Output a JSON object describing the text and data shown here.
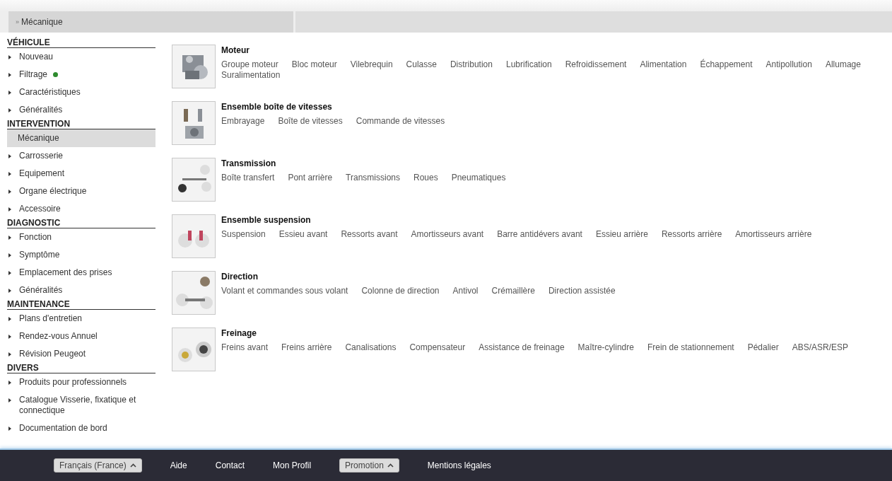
{
  "breadcrumb": {
    "marker": "»",
    "label": "Mécanique"
  },
  "sidebar": {
    "sections": [
      {
        "heading": "VÉHICULE",
        "items": [
          {
            "label": "Nouveau",
            "selected": false
          },
          {
            "label": "Filtrage",
            "selected": false,
            "color": "#2e8b2e"
          },
          {
            "label": "Caractéristiques",
            "selected": false
          },
          {
            "label": "Généralités",
            "selected": false
          }
        ]
      },
      {
        "heading": "INTERVENTION",
        "items": [
          {
            "label": "Mécanique",
            "selected": true
          },
          {
            "label": "Carrosserie",
            "selected": false
          },
          {
            "label": "Equipement",
            "selected": false
          },
          {
            "label": "Organe électrique",
            "selected": false
          },
          {
            "label": "Accessoire",
            "selected": false
          }
        ]
      },
      {
        "heading": "DIAGNOSTIC",
        "items": [
          {
            "label": "Fonction",
            "selected": false
          },
          {
            "label": "Symptôme",
            "selected": false
          },
          {
            "label": "Emplacement des prises",
            "selected": false
          },
          {
            "label": "Généralités",
            "selected": false
          }
        ]
      },
      {
        "heading": "MAINTENANCE",
        "items": [
          {
            "label": "Plans d'entretien",
            "selected": false
          },
          {
            "label": "Rendez-vous Annuel",
            "selected": false
          },
          {
            "label": "Révision Peugeot",
            "selected": false
          }
        ]
      },
      {
        "heading": "DIVERS",
        "items": [
          {
            "label": "Produits pour professionnels",
            "selected": false
          },
          {
            "label": "Catalogue Visserie, fixatique et connectique",
            "selected": false
          },
          {
            "label": "Documentation de bord",
            "selected": false
          }
        ]
      }
    ]
  },
  "groups": [
    {
      "title": "Moteur",
      "image": {
        "kind": "picture"
      },
      "links": [
        "Groupe moteur",
        "Bloc moteur",
        "Vilebrequin",
        "Culasse",
        "Distribution",
        "Lubrification",
        "Refroidissement",
        "Alimentation",
        "Échappement",
        "Antipollution",
        "Allumage",
        "Suralimentation"
      ]
    },
    {
      "title": "Ensemble boîte de vitesses",
      "image": {
        "kind": "picture"
      },
      "links": [
        "Embrayage",
        "Boîte de vitesses",
        "Commande de vitesses"
      ]
    },
    {
      "title": "Transmission",
      "image": {
        "kind": "picture"
      },
      "links": [
        "Boîte transfert",
        "Pont arrière",
        "Transmissions",
        "Roues",
        "Pneumatiques"
      ]
    },
    {
      "title": "Ensemble suspension",
      "image": {
        "kind": "picture"
      },
      "links": [
        "Suspension",
        "Essieu avant",
        "Ressorts avant",
        "Amortisseurs avant",
        "Barre antidévers avant",
        "Essieu arrière",
        "Ressorts arrière",
        "Amortisseurs arrière"
      ]
    },
    {
      "title": "Direction",
      "image": {
        "kind": "picture"
      },
      "links": [
        "Volant et commandes sous volant",
        "Colonne de direction",
        "Antivol",
        "Crémaillère",
        "Direction assistée"
      ]
    },
    {
      "title": "Freinage",
      "image": {
        "kind": "picture"
      },
      "links": [
        "Freins avant",
        "Freins arrière",
        "Canalisations",
        "Compensateur",
        "Assistance de freinage",
        "Maître-cylindre",
        "Frein de stationnement",
        "Pédalier",
        "ABS/ASR/ESP"
      ]
    }
  ],
  "footer": [
    {
      "kind": "dropdown",
      "label": "Français (France)"
    },
    {
      "kind": "link",
      "label": "Aide"
    },
    {
      "kind": "link",
      "label": "Contact"
    },
    {
      "kind": "link",
      "label": "Mon Profil"
    },
    {
      "kind": "dropdown",
      "label": "Promotion"
    },
    {
      "kind": "link",
      "label": "Mentions légales"
    }
  ]
}
